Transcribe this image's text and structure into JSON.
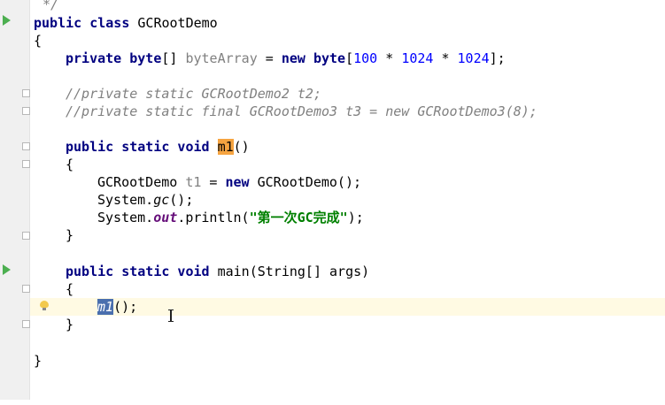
{
  "code": {
    "comment_end": "*/",
    "class_kw": "public class",
    "class_name": "GCRootDemo",
    "open_brace": "{",
    "close_brace": "}",
    "field": {
      "mod": "private byte",
      "brackets": "[] ",
      "name": "byteArray",
      "eq": " = ",
      "new_byte": "new byte",
      "lb": "[",
      "n1": "100",
      "op1": " * ",
      "n2": "1024",
      "op2": " * ",
      "n3": "1024",
      "end": "];"
    },
    "comment1": "//private static GCRootDemo2 t2;",
    "comment2": "//private static final GCRootDemo3 t3 = new GCRootDemo3(8);",
    "m1_decl": {
      "mods": "public static void ",
      "name": "m1",
      "parens": "()"
    },
    "body1": {
      "type": "GCRootDemo ",
      "var": "t1",
      "eq": " = ",
      "new": "new",
      "ctor": " GCRootDemo();"
    },
    "body2": {
      "sys": "System.",
      "gc": "gc",
      "end": "();"
    },
    "body3": {
      "sys": "System.",
      "out": "out",
      "println": ".println(",
      "str": "\"第一次GC完成\"",
      "end": ");"
    },
    "main_decl": {
      "mods": "public static void",
      "sig": " main(String[] args)"
    },
    "call": {
      "name": "m1",
      "end": "();"
    }
  },
  "colors": {
    "keyword": "#000080",
    "comment": "#808080",
    "number": "#0000ff",
    "string": "#008000",
    "static_field": "#660e7a",
    "run_icon": "#4caf50",
    "caret_row": "#fffae3"
  },
  "icons": [
    "run-icon",
    "fold-icon",
    "bulb-icon",
    "text-cursor-icon"
  ]
}
